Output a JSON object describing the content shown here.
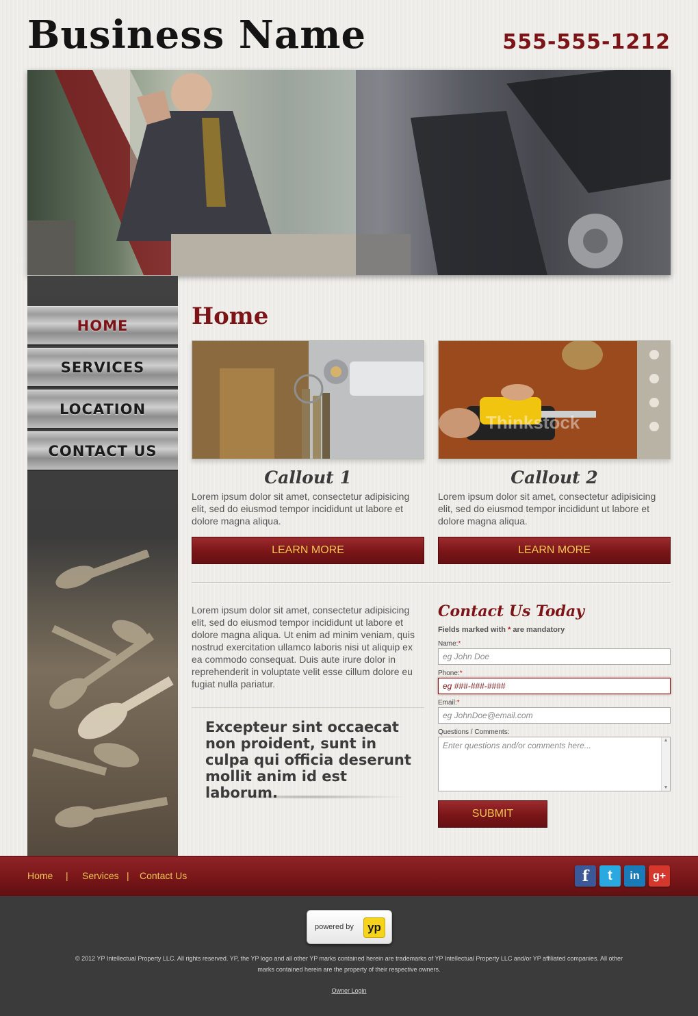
{
  "header": {
    "business_name": "Business Name",
    "phone": "555-555-1212"
  },
  "nav": {
    "items": [
      {
        "label": "HOME",
        "active": true
      },
      {
        "label": "SERVICES",
        "active": false
      },
      {
        "label": "LOCATION",
        "active": false
      },
      {
        "label": "CONTACT US",
        "active": false
      }
    ]
  },
  "main": {
    "title": "Home",
    "callouts": [
      {
        "title": "Callout 1",
        "text": "Lorem ipsum dolor sit amet, consectetur adipisicing elit, sed do eiusmod tempor incididunt ut labore et dolore magna aliqua.",
        "button": "LEARN MORE"
      },
      {
        "title": "Callout 2",
        "text": "Lorem ipsum dolor sit amet, consectetur adipisicing elit, sed do eiusmod tempor incididunt ut labore et dolore magna aliqua.",
        "button": "LEARN MORE",
        "watermark": "Thinkstock"
      }
    ],
    "body_text": "Lorem ipsum dolor sit amet, consectetur adipisicing elit, sed do eiusmod tempor incididunt ut labore et dolore magna aliqua. Ut enim ad minim veniam, quis nostrud exercitation ullamco laboris nisi ut aliquip ex ea commodo consequat. Duis aute irure dolor in reprehenderit in voluptate velit esse cillum dolore eu fugiat nulla pariatur.",
    "quote": "Excepteur sint occaecat non proident, sunt in culpa qui officia deserunt mollit anim id est laborum."
  },
  "form": {
    "title": "Contact Us Today",
    "note_prefix": "Fields marked with ",
    "note_star": "*",
    "note_suffix": " are mandatory",
    "required_mark": "*",
    "name_label": "Name:",
    "name_placeholder": "eg John Doe",
    "phone_label": "Phone:",
    "phone_placeholder": "eg ###-###-####",
    "email_label": "Email:",
    "email_placeholder": "eg JohnDoe@email.com",
    "comments_label": "Questions / Comments:",
    "comments_placeholder": "Enter questions and/or comments here...",
    "submit": "SUBMIT"
  },
  "footer": {
    "links": [
      "Home",
      "Services",
      "Contact Us"
    ],
    "separator": "|",
    "social": [
      {
        "icon": "facebook-icon",
        "glyph": "f",
        "color": "#3b5998"
      },
      {
        "icon": "twitter-icon",
        "glyph": "t",
        "color": "#2aa9e0"
      },
      {
        "icon": "linkedin-icon",
        "glyph": "in",
        "color": "#1a7bb9"
      },
      {
        "icon": "google-plus-icon",
        "glyph": "g+",
        "color": "#d4382c"
      }
    ],
    "powered_by": "powered by",
    "yp_logo": "yp",
    "copyright": "© 2012  YP Intellectual Property LLC. All rights reserved. YP, the YP logo and all other YP marks contained herein are trademarks of YP Intellectual Property LLC and/or YP affiliated companies. All other marks contained herein are the property of their respective owners.",
    "owner_login": "Owner Login"
  },
  "colors": {
    "accent": "#7c1417",
    "link_gold": "#f2c552",
    "footer_dark": "#3b3b3b"
  }
}
